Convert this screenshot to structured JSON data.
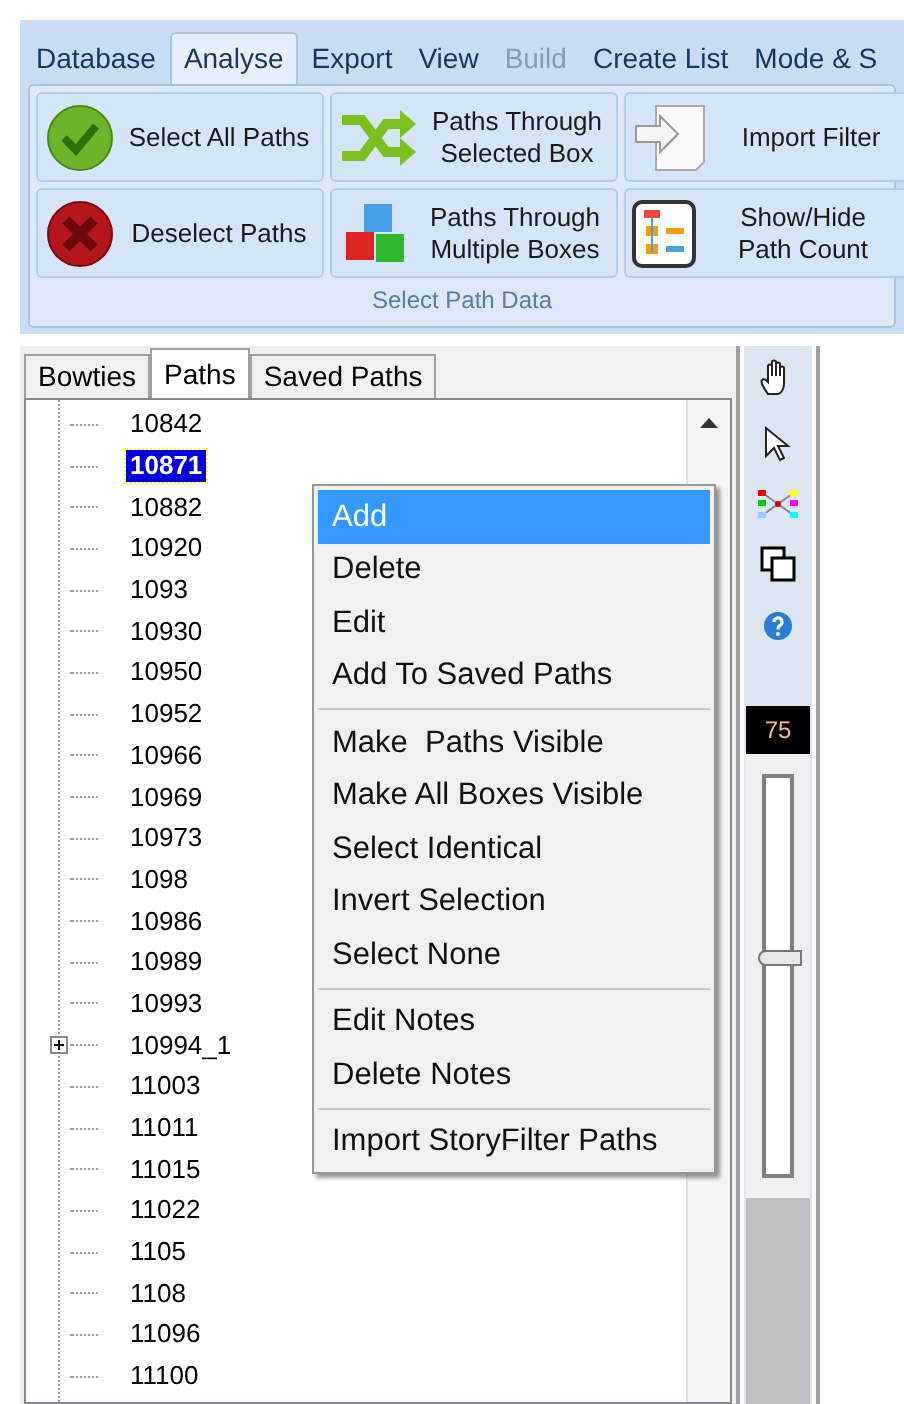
{
  "ribbon_tabs": [
    {
      "label": "Database",
      "selected": false,
      "disabled": false
    },
    {
      "label": "Analyse",
      "selected": true,
      "disabled": false
    },
    {
      "label": "Export",
      "selected": false,
      "disabled": false
    },
    {
      "label": "View",
      "selected": false,
      "disabled": false
    },
    {
      "label": "Build",
      "selected": false,
      "disabled": true
    },
    {
      "label": "Create List",
      "selected": false,
      "disabled": false
    },
    {
      "label": "Mode & S",
      "selected": false,
      "disabled": false
    }
  ],
  "ribbon_group": {
    "label": "Select Path Data",
    "buttons": [
      {
        "kind": "check",
        "label": "Select All Paths"
      },
      {
        "kind": "shuffle",
        "label": "Paths Through Selected Box"
      },
      {
        "kind": "import",
        "label": "Import Filter"
      },
      {
        "kind": "cross",
        "label": "Deselect Paths"
      },
      {
        "kind": "cubes",
        "label": "Paths Through Multiple Boxes"
      },
      {
        "kind": "flow",
        "label": "Show/Hide Path Count"
      }
    ]
  },
  "panel_tabs": [
    {
      "label": "Bowties",
      "selected": false
    },
    {
      "label": "Paths",
      "selected": true
    },
    {
      "label": "Saved Paths",
      "selected": false
    }
  ],
  "tree": [
    {
      "label": "10842",
      "selected": false,
      "kind": "leaf"
    },
    {
      "label": "10871",
      "selected": true,
      "kind": "leaf"
    },
    {
      "label": "10882",
      "selected": false,
      "kind": "leaf"
    },
    {
      "label": "10920",
      "selected": false,
      "kind": "leaf"
    },
    {
      "label": "1093",
      "selected": false,
      "kind": "leaf"
    },
    {
      "label": "10930",
      "selected": false,
      "kind": "leaf"
    },
    {
      "label": "10950",
      "selected": false,
      "kind": "leaf"
    },
    {
      "label": "10952",
      "selected": false,
      "kind": "leaf"
    },
    {
      "label": "10966",
      "selected": false,
      "kind": "leaf"
    },
    {
      "label": "10969",
      "selected": false,
      "kind": "leaf"
    },
    {
      "label": "10973",
      "selected": false,
      "kind": "leaf"
    },
    {
      "label": "1098",
      "selected": false,
      "kind": "leaf"
    },
    {
      "label": "10986",
      "selected": false,
      "kind": "leaf"
    },
    {
      "label": "10989",
      "selected": false,
      "kind": "leaf"
    },
    {
      "label": "10993",
      "selected": false,
      "kind": "leaf"
    },
    {
      "label": "10994_1",
      "selected": false,
      "kind": "collapsed"
    },
    {
      "label": "11003",
      "selected": false,
      "kind": "leaf"
    },
    {
      "label": "11011",
      "selected": false,
      "kind": "leaf"
    },
    {
      "label": "11015",
      "selected": false,
      "kind": "leaf"
    },
    {
      "label": "11022",
      "selected": false,
      "kind": "leaf"
    },
    {
      "label": "1105",
      "selected": false,
      "kind": "leaf"
    },
    {
      "label": "1108",
      "selected": false,
      "kind": "leaf"
    },
    {
      "label": "11096",
      "selected": false,
      "kind": "leaf"
    },
    {
      "label": "11100",
      "selected": false,
      "kind": "leaf"
    }
  ],
  "context_menu": {
    "groups": [
      [
        {
          "label": "Add",
          "selected": true
        },
        {
          "label": "Delete",
          "selected": false
        },
        {
          "label": "Edit",
          "selected": false
        },
        {
          "label": "Add To Saved Paths",
          "selected": false
        }
      ],
      [
        {
          "label": "Make  Paths Visible",
          "selected": false
        },
        {
          "label": "Make All Boxes Visible",
          "selected": false
        },
        {
          "label": "Select Identical",
          "selected": false
        },
        {
          "label": "Invert Selection",
          "selected": false
        },
        {
          "label": "Select None",
          "selected": false
        }
      ],
      [
        {
          "label": "Edit Notes",
          "selected": false
        },
        {
          "label": "Delete Notes",
          "selected": false
        }
      ],
      [
        {
          "label": "Import StoryFilter Paths",
          "selected": false
        }
      ]
    ]
  },
  "tool_strip": {
    "zoom_reading": "75",
    "zoom": {
      "level": 0.55
    }
  }
}
